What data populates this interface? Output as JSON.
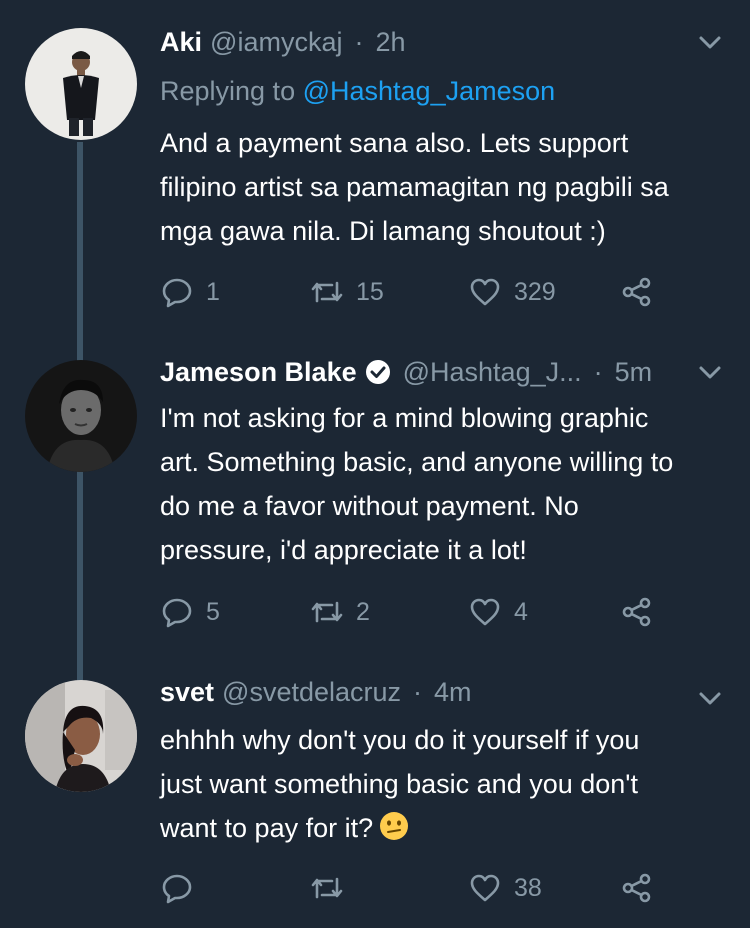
{
  "colors": {
    "background": "#1c2734",
    "muted": "#8899a6",
    "link": "#1da1f2",
    "thread_line": "#3d5466"
  },
  "tweets": [
    {
      "name": "Aki",
      "handle": "@iamyckaj",
      "separator": "·",
      "time": "2h",
      "verified": false,
      "replying_prefix": "Replying to ",
      "replying_to": "@Hashtag_Jameson",
      "body": [
        "And a payment sana also. Lets support",
        "filipino artist sa pamamagitan ng pagbili sa",
        "mga gawa nila. Di lamang shoutout :)"
      ],
      "replies": "1",
      "retweets": "15",
      "likes": "329"
    },
    {
      "name": "Jameson Blake",
      "handle": "@Hashtag_J...",
      "separator": "·",
      "time": "5m",
      "verified": true,
      "body": [
        "I'm not asking for a mind blowing graphic",
        "art. Something basic, and anyone willing to",
        "do me a favor without payment. No",
        "pressure, i'd appreciate it a lot!"
      ],
      "replies": "5",
      "retweets": "2",
      "likes": "4"
    },
    {
      "name": "svet",
      "handle": "@svetdelacruz",
      "separator": "·",
      "time": "4m",
      "verified": false,
      "body": [
        "ehhhh why don't you do it yourself if you",
        "just want something basic and you don't",
        "want to pay for it?"
      ],
      "body_emoji": "confused-face-emoji",
      "replies": "",
      "retweets": "",
      "likes": "38"
    }
  ]
}
